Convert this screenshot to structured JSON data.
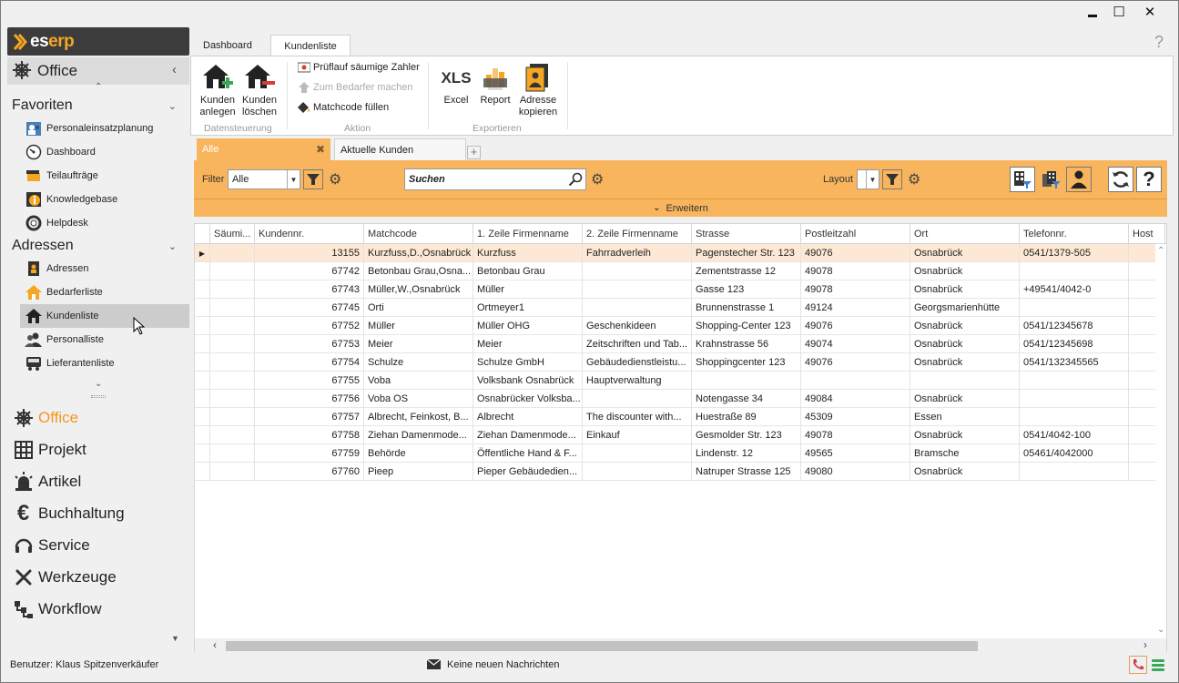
{
  "window": {
    "controls": {
      "minimize": "▬",
      "maximize": "☐",
      "close": "✕"
    }
  },
  "logo": {
    "prefix": "es",
    "suffix": "erp"
  },
  "sidebar": {
    "header": "Office",
    "favorites_title": "Favoriten",
    "favorites": [
      {
        "label": "Personaleinsatzplanung",
        "icon": "people-calendar-icon"
      },
      {
        "label": "Dashboard",
        "icon": "gauge-icon"
      },
      {
        "label": "Teilaufträge",
        "icon": "documents-icon"
      },
      {
        "label": "Knowledgebase",
        "icon": "info-icon"
      },
      {
        "label": "Helpdesk",
        "icon": "lifebuoy-icon"
      }
    ],
    "addresses_title": "Adressen",
    "addresses": [
      {
        "label": "Adressen",
        "icon": "address-book-icon"
      },
      {
        "label": "Bedarferliste",
        "icon": "house-outline-icon"
      },
      {
        "label": "Kundenliste",
        "icon": "house-icon"
      },
      {
        "label": "Personalliste",
        "icon": "people-icon"
      },
      {
        "label": "Lieferantenliste",
        "icon": "truck-icon"
      }
    ],
    "modules": [
      {
        "label": "Office",
        "icon": "helm-icon"
      },
      {
        "label": "Projekt",
        "icon": "grid-icon"
      },
      {
        "label": "Artikel",
        "icon": "siren-icon"
      },
      {
        "label": "Buchhaltung",
        "icon": "euro-icon"
      },
      {
        "label": "Service",
        "icon": "headset-icon"
      },
      {
        "label": "Werkzeuge",
        "icon": "tools-icon"
      },
      {
        "label": "Workflow",
        "icon": "workflow-icon"
      }
    ]
  },
  "ribbon": {
    "tabs": [
      "Dashboard",
      "Kundenliste"
    ],
    "help": "?",
    "buttons": {
      "kunden_anlegen": "Kunden anlegen",
      "kunden_loeschen": "Kunden löschen",
      "pruflauf": "Prüflauf säumige Zahler",
      "zum_bedarfer": "Zum Bedarfer machen",
      "matchcode": "Matchcode füllen",
      "excel_icon_text": "XLS",
      "excel": "Excel",
      "report": "Report",
      "adresse_kopieren": "Adresse kopieren"
    },
    "groups": {
      "datensteuerung": "Datensteuerung",
      "aktion": "Aktion",
      "exportieren": "Exportieren"
    }
  },
  "view_tabs": {
    "active": "Alle",
    "inactive": "Aktuelle Kunden",
    "add": "+"
  },
  "toolbar": {
    "filter_label": "Filter",
    "filter_value": "Alle",
    "search_placeholder": "Suchen",
    "layout_label": "Layout",
    "layout_value": "",
    "expand_label": "Erweitern",
    "help": "?"
  },
  "grid": {
    "columns": [
      "Säumi...",
      "Kundennr.",
      "Matchcode",
      "1. Zeile Firmenname",
      "2. Zeile Firmenname",
      "Strasse",
      "Postleitzahl",
      "Ort",
      "Telefonnr.",
      "Host"
    ],
    "rows": [
      [
        "",
        "13155",
        "Kurzfuss,D.,Osnabrück",
        "Kurzfuss",
        "Fahrradverleih",
        "Pagenstecher Str. 123",
        "49076",
        "Osnabrück",
        "0541/1379-505",
        ""
      ],
      [
        "",
        "67742",
        "Betonbau Grau,Osna...",
        "Betonbau Grau",
        "",
        "Zementstrasse 12",
        "49078",
        "Osnabrück",
        "",
        ""
      ],
      [
        "",
        "67743",
        "Müller,W.,Osnabrück",
        "Müller",
        "",
        "Gasse 123",
        "49078",
        "Osnabrück",
        "+49541/4042-0",
        ""
      ],
      [
        "",
        "67745",
        "Orti",
        "Ortmeyer1",
        "",
        "Brunnenstrasse 1",
        "49124",
        "Georgsmarienhütte",
        "",
        ""
      ],
      [
        "",
        "67752",
        "Müller",
        "Müller OHG",
        "Geschenkideen",
        "Shopping-Center 123",
        "49076",
        "Osnabrück",
        "0541/12345678",
        ""
      ],
      [
        "",
        "67753",
        "Meier",
        "Meier",
        "Zeitschriften und Tab...",
        "Krahnstrasse 56",
        "49074",
        "Osnabrück",
        "0541/12345698",
        ""
      ],
      [
        "",
        "67754",
        "Schulze",
        "Schulze GmbH",
        "Gebäudedienstleistu...",
        "Shoppingcenter 123",
        "49076",
        "Osnabrück",
        "0541/132345565",
        ""
      ],
      [
        "",
        "67755",
        "Voba",
        "Volksbank Osnabrück",
        "Hauptverwaltung",
        "",
        "",
        "",
        "",
        ""
      ],
      [
        "",
        "67756",
        "Voba OS",
        "Osnabrücker Volksba...",
        "",
        "Notengasse 34",
        "49084",
        "Osnabrück",
        "",
        ""
      ],
      [
        "",
        "67757",
        "Albrecht, Feinkost, B...",
        "Albrecht",
        "The discounter with...",
        "Huestraße 89",
        "45309",
        "Essen",
        "",
        ""
      ],
      [
        "",
        "67758",
        "Ziehan Damenmode...",
        "Ziehan Damenmode...",
        "Einkauf",
        "Gesmolder Str. 123",
        "49078",
        "Osnabrück",
        "0541/4042-100",
        ""
      ],
      [
        "",
        "67759",
        "Behörde",
        "Öffentliche Hand & F...",
        "",
        "Lindenstr. 12",
        "49565",
        "Bramsche",
        "05461/4042000",
        ""
      ],
      [
        "",
        "67760",
        "Pieep",
        "Pieper Gebäudedien...",
        "",
        "Natruper Strasse 125",
        "49080",
        "Osnabrück",
        "",
        ""
      ]
    ]
  },
  "statusbar": {
    "user": "Benutzer: Klaus Spitzenverkäufer",
    "messages": "Keine neuen Nachrichten"
  },
  "colors": {
    "accent": "#f8b55d",
    "active_module": "#f5961c",
    "logo_bg": "#3c3c3c",
    "selected_row": "#fde8d6"
  }
}
